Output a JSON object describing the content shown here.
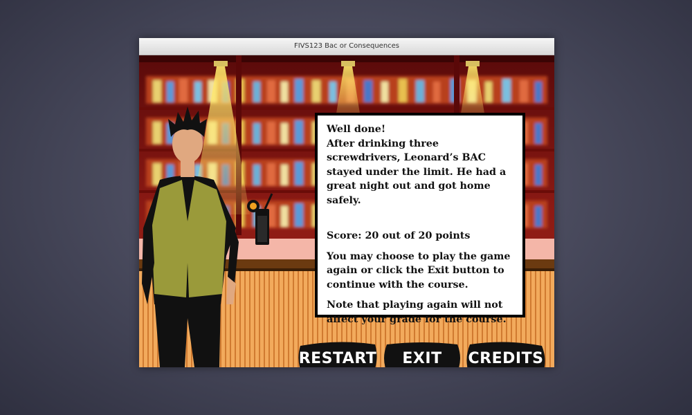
{
  "window": {
    "title": "FIVS123 Bac or Consequences"
  },
  "dialog": {
    "heading": "Well done!",
    "result": "After drinking three screwdrivers, Leonard’s BAC stayed under the limit. He had a great night out and got home safely.",
    "score": "Score: 20 out of 20 points",
    "instructions": "You may choose to play the game again or click the Exit button to continue with the course.",
    "note": "Note that playing again will not affect your grade for the course."
  },
  "buttons": {
    "restart": "RESTART",
    "exit": "EXIT",
    "credits": "CREDITS"
  },
  "colors": {
    "bar_red": "#8b1414",
    "counter_orange": "#f0a860",
    "vest_olive": "#9a9a3a",
    "button_black": "#111111"
  }
}
